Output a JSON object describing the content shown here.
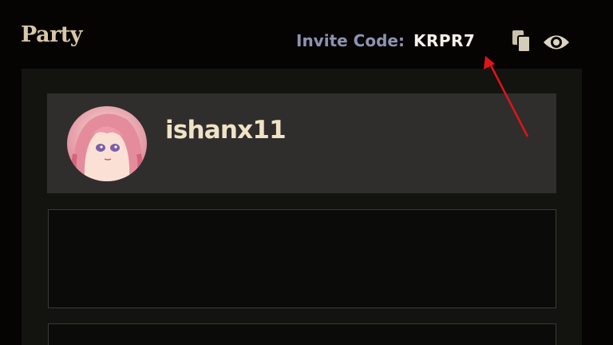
{
  "header": {
    "title": "Party",
    "invite_label": "Invite Code:",
    "invite_code": "KRPR7",
    "copy_icon": "copy-icon",
    "visibility_icon": "eye-icon"
  },
  "party": {
    "members": [
      {
        "name": "ishanx11",
        "avatar": "anime-avatar"
      }
    ],
    "empty_slots": 2
  },
  "colors": {
    "background": "#050403",
    "panel": "#131410",
    "member_card": "#2f2e2c",
    "title": "#d8c7a6",
    "invite_label": "#8f92b0",
    "invite_code": "#f6f1ea",
    "member_name": "#f0e2c6",
    "annotation": "#e0141a"
  }
}
